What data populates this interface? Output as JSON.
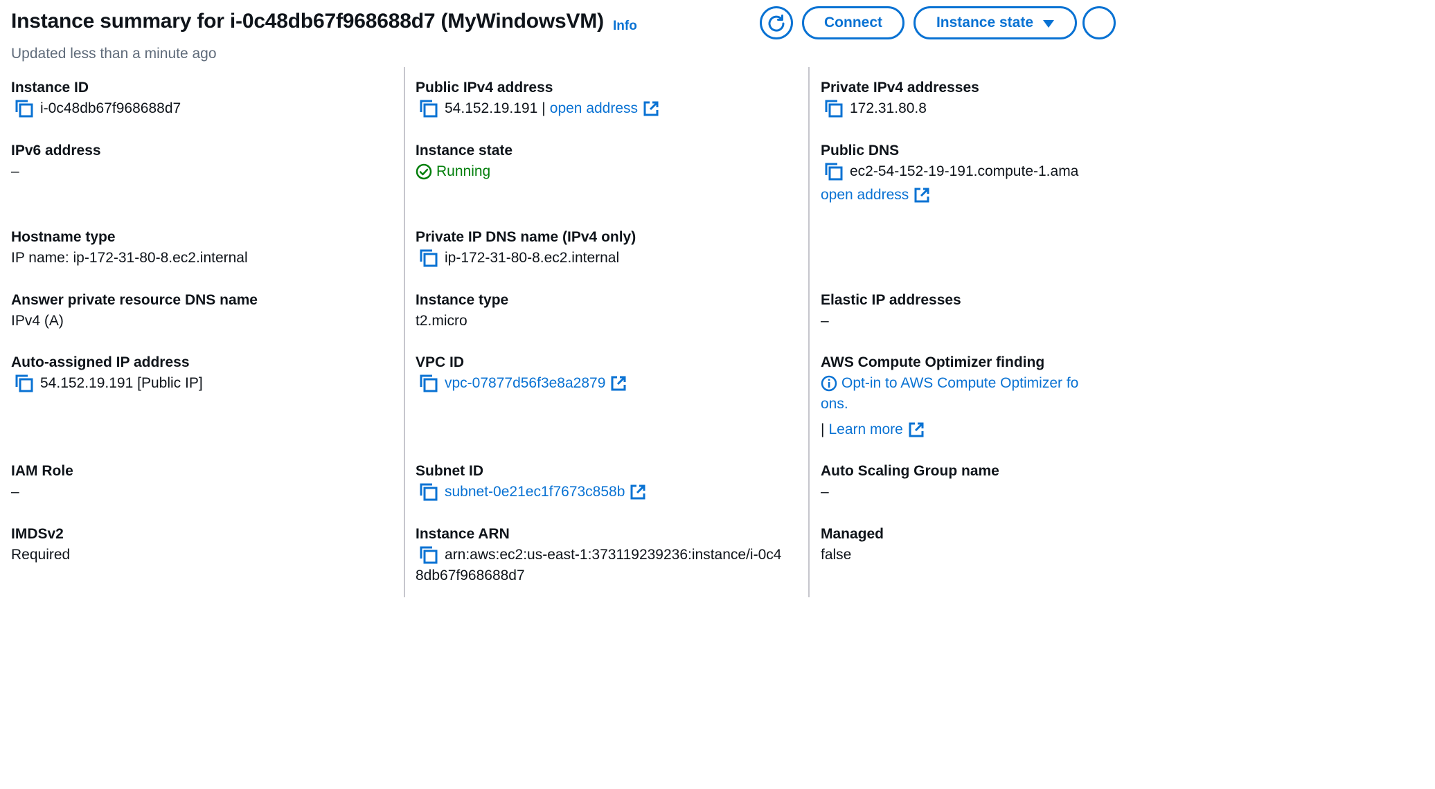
{
  "header": {
    "title": "Instance summary for i-0c48db67f968688d7 (MyWindowsVM)",
    "info": "Info",
    "updated": "Updated less than a minute ago",
    "connect_label": "Connect",
    "instance_state_label": "Instance state"
  },
  "col1": {
    "instance_id_label": "Instance ID",
    "instance_id": "i-0c48db67f968688d7",
    "ipv6_label": "IPv6 address",
    "ipv6": "–",
    "hostname_type_label": "Hostname type",
    "hostname_type": "IP name: ip-172-31-80-8.ec2.internal",
    "answer_dns_label": "Answer private resource DNS name",
    "answer_dns": "IPv4 (A)",
    "auto_ip_label": "Auto-assigned IP address",
    "auto_ip": "54.152.19.191 [Public IP]",
    "iam_label": "IAM Role",
    "iam": "–",
    "imds_label": "IMDSv2",
    "imds": "Required"
  },
  "col2": {
    "public_ipv4_label": "Public IPv4 address",
    "public_ipv4": "54.152.19.191",
    "public_ipv4_sep": "|",
    "open_address": "open address",
    "state_label": "Instance state",
    "state": "Running",
    "private_dns_label": "Private IP DNS name (IPv4 only)",
    "private_dns": "ip-172-31-80-8.ec2.internal",
    "type_label": "Instance type",
    "type": "t2.micro",
    "vpc_label": "VPC ID",
    "vpc": "vpc-07877d56f3e8a2879",
    "subnet_label": "Subnet ID",
    "subnet": "subnet-0e21ec1f7673c858b",
    "arn_label": "Instance ARN",
    "arn_line1": "arn:aws:ec2:us-east-1:373119239236:instance/i-0c4",
    "arn_line2": "8db67f968688d7"
  },
  "col3": {
    "private_ipv4_label": "Private IPv4 addresses",
    "private_ipv4": "172.31.80.8",
    "public_dns_label": "Public DNS",
    "public_dns": "ec2-54-152-19-191.compute-1.ama",
    "open_address": "open address",
    "elastic_label": "Elastic IP addresses",
    "elastic": "–",
    "optimizer_label": "AWS Compute Optimizer finding",
    "optimizer_line1": "Opt-in to AWS Compute Optimizer fo",
    "optimizer_line2": "ons.",
    "learn_sep": "|",
    "learn_more": "Learn more",
    "asg_label": "Auto Scaling Group name",
    "asg": "–",
    "managed_label": "Managed",
    "managed": "false"
  },
  "colors": {
    "link": "#0972d3",
    "success": "#037f0c",
    "divider": "#c6c6cd",
    "text": "#0f141a",
    "muted": "#5f6b7a"
  },
  "icons": [
    "copy-icon",
    "external-link-icon",
    "refresh-icon",
    "caret-down-icon",
    "status-success-icon",
    "info-circle-icon"
  ]
}
